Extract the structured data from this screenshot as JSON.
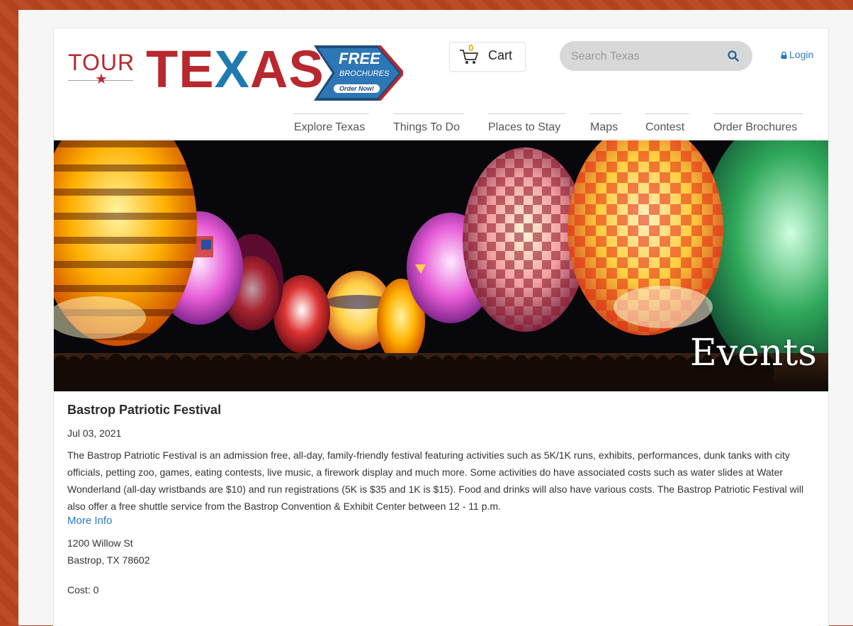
{
  "header": {
    "logo": {
      "tour": "TOUR",
      "texas": "TEXAS",
      "badge_free": "FREE",
      "badge_brochures": "BROCHURES",
      "badge_order": "Order Now!"
    },
    "cart": {
      "count": "0",
      "label": "Cart"
    },
    "search": {
      "placeholder": "Search Texas"
    },
    "login": {
      "label": "Login"
    }
  },
  "nav": {
    "items": [
      {
        "label": "Explore Texas"
      },
      {
        "label": "Things To Do"
      },
      {
        "label": "Places to Stay"
      },
      {
        "label": "Maps"
      },
      {
        "label": "Contest"
      },
      {
        "label": "Order Brochures"
      }
    ]
  },
  "hero": {
    "title": "Events"
  },
  "event": {
    "title": "Bastrop Patriotic Festival",
    "date": "Jul 03, 2021",
    "description": "The Bastrop Patriotic Festival is an admission free, all-day, family-friendly festival featuring activities such as 5K/1K runs, exhibits, performances, dunk tanks with city officials, petting zoo, games, eating contests, live music, a firework display and much more. Some activities do have associated costs such as water slides at Water Wonderland (all-day wristbands are $10) and run registrations (5K is $35 and 1K is $15). Food and drinks will also have various costs. The Bastrop Patriotic Festival will also offer a free shuttle service from the Bastrop Convention & Exhibit Center between 12 - 11 p.m.",
    "more_info": "More Info",
    "address_line1": "1200 Willow St",
    "address_line2": "Bastrop, TX 78602",
    "cost": "Cost: 0"
  },
  "colors": {
    "brand_red": "#b8282e",
    "brand_blue": "#1f7ab0",
    "link": "#2a7bbf",
    "background": "#b9461f"
  }
}
